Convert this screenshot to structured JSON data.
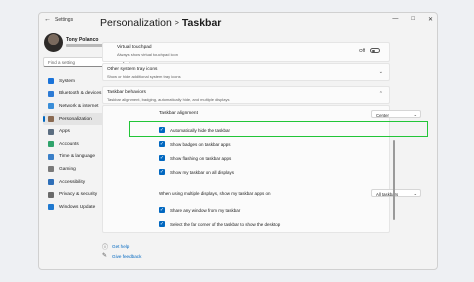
{
  "window": {
    "app_title": "Settings",
    "back_icon": "back-arrow-icon",
    "controls": [
      "minimize-icon",
      "maximize-icon",
      "close-icon"
    ]
  },
  "user": {
    "name": "Tony Polanco"
  },
  "search": {
    "placeholder": "Find a setting"
  },
  "nav": [
    {
      "label": "System",
      "icon": "system-icon",
      "color": "#1a73d9"
    },
    {
      "label": "Bluetooth & devices",
      "icon": "bluetooth-icon",
      "color": "#2d7bd5"
    },
    {
      "label": "Network & internet",
      "icon": "network-icon",
      "color": "#3a8ed8"
    },
    {
      "label": "Personalization",
      "icon": "personalization-icon",
      "color": "#8a6a52",
      "active": true
    },
    {
      "label": "Apps",
      "icon": "apps-icon",
      "color": "#5b6d80"
    },
    {
      "label": "Accounts",
      "icon": "accounts-icon",
      "color": "#2fa36b"
    },
    {
      "label": "Time & language",
      "icon": "time-icon",
      "color": "#3a7fc8"
    },
    {
      "label": "Gaming",
      "icon": "gaming-icon",
      "color": "#7a7a7a"
    },
    {
      "label": "Accessibility",
      "icon": "accessibility-icon",
      "color": "#2f6fb8"
    },
    {
      "label": "Privacy & security",
      "icon": "privacy-icon",
      "color": "#6a6a6a"
    },
    {
      "label": "Windows Update",
      "icon": "windows-update-icon",
      "color": "#1f79d0"
    }
  ],
  "breadcrumb": {
    "parent": "Personalization",
    "separator": ">",
    "current": "Taskbar"
  },
  "touchpad": {
    "title": "Virtual touchpad",
    "desc": "Always show virtual touchpad icon",
    "state": "Off"
  },
  "tray": {
    "title": "Other system tray icons",
    "desc": "Show or hide additional system tray icons"
  },
  "behaviors": {
    "title": "Taskbar behaviors",
    "desc": "Taskbar alignment, badging, automatically hide, and multiple displays",
    "alignment_label": "Taskbar alignment",
    "alignment_value": "Center",
    "checkboxes": [
      "Automatically hide the taskbar",
      "Show badges on taskbar apps",
      "Show flashing on taskbar apps",
      "Show my taskbar on all displays"
    ],
    "multi_label": "When using multiple displays, show my taskbar apps on",
    "multi_value": "All taskbars",
    "checkboxes2": [
      "Share any window from my taskbar",
      "Select the far corner of the taskbar to show the desktop"
    ]
  },
  "links": {
    "help": "Get help",
    "feedback": "Give feedback"
  },
  "colors": {
    "accent": "#0067c0",
    "highlight": "#22c538"
  }
}
